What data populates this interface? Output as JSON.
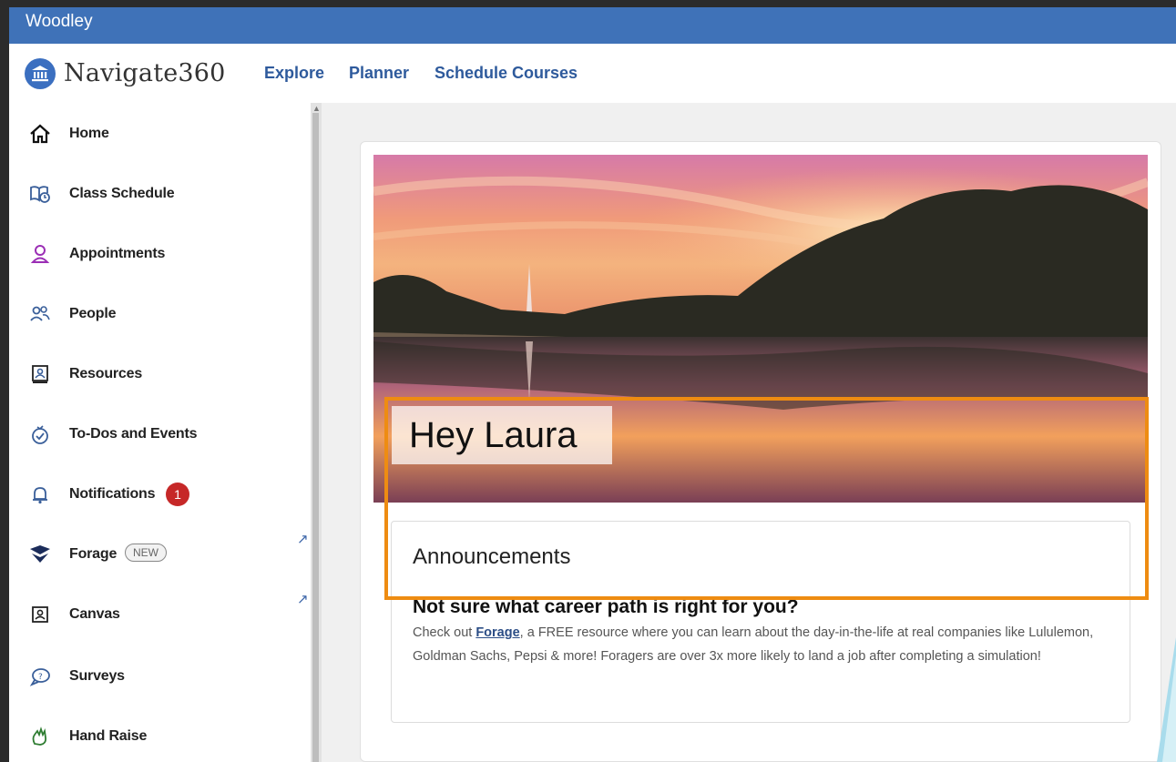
{
  "org": {
    "name": "Woodley"
  },
  "header": {
    "logo_text": "Navigate360",
    "nav": [
      "Explore",
      "Planner",
      "Schedule Courses"
    ]
  },
  "sidebar": {
    "items": [
      {
        "label": "Home",
        "icon": "home-icon"
      },
      {
        "label": "Class Schedule",
        "icon": "class-schedule-icon"
      },
      {
        "label": "Appointments",
        "icon": "person-icon"
      },
      {
        "label": "People",
        "icon": "people-icon"
      },
      {
        "label": "Resources",
        "icon": "resources-icon"
      },
      {
        "label": "To-Dos and Events",
        "icon": "todo-icon"
      },
      {
        "label": "Notifications",
        "icon": "bell-icon",
        "badge": "1"
      },
      {
        "label": "Forage",
        "icon": "forage-logo-icon",
        "pill": "NEW",
        "external": true
      },
      {
        "label": "Canvas",
        "icon": "canvas-icon",
        "external": true
      },
      {
        "label": "Surveys",
        "icon": "chat-bubble-icon"
      },
      {
        "label": "Hand Raise",
        "icon": "hand-raise-icon"
      }
    ],
    "external_arrow": "↗"
  },
  "main": {
    "greeting": "Hey Laura",
    "announcements": {
      "title": "Announcements",
      "headline": "Not sure what career path is right for you?",
      "body_before": "Check out ",
      "body_link": "Forage",
      "body_after": ", a FREE resource where you can learn about the day-in-the-life at real companies like Lululemon, Goldman Sachs, Pepsi & more! Foragers are over 3x more likely to land a job after completing a simulation!"
    }
  },
  "colors": {
    "org_bar": "#3f72b8",
    "nav_link": "#2e5a9c",
    "highlight_box": "#ee8c12",
    "badge": "#c62828"
  }
}
